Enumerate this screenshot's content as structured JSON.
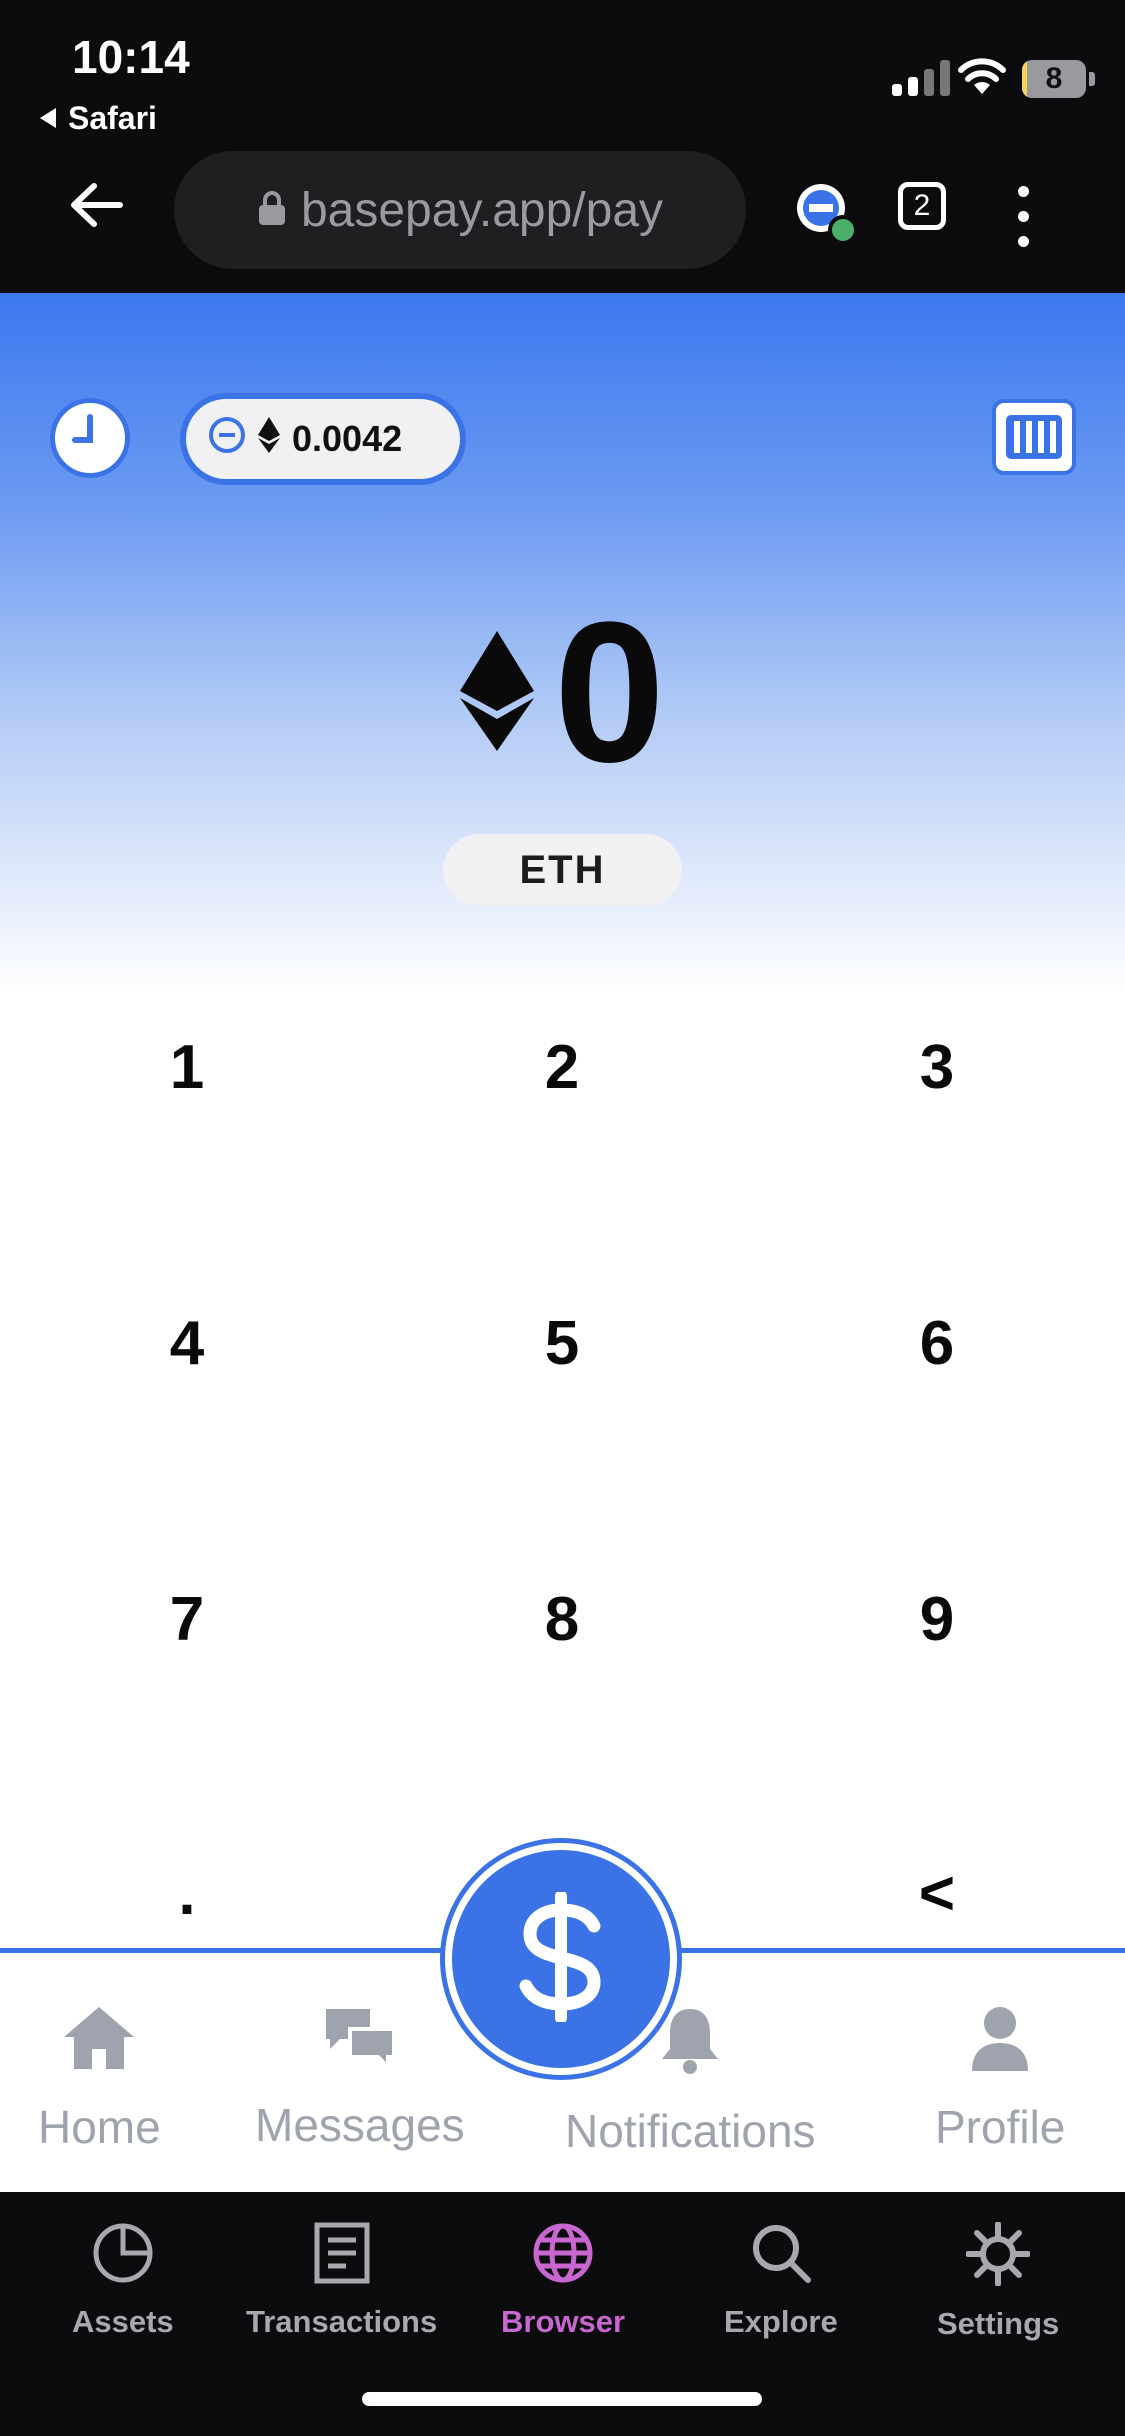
{
  "status": {
    "time": "10:14",
    "back_app": "Safari",
    "battery": "8",
    "battery_level": 0.08
  },
  "browser": {
    "url": "basepay.app/pay",
    "tab_count": "2"
  },
  "page": {
    "balance": "0.0042",
    "amount": "0",
    "currency": "ETH",
    "keypad": [
      "1",
      "2",
      "3",
      "4",
      "5",
      "6",
      "7",
      "8",
      "9",
      ".",
      "<"
    ]
  },
  "app_nav": {
    "items": [
      {
        "label": "Home",
        "icon": "home-icon"
      },
      {
        "label": "Messages",
        "icon": "messages-icon"
      },
      {
        "label": "Notifications",
        "icon": "bell-icon"
      },
      {
        "label": "Profile",
        "icon": "person-icon"
      }
    ],
    "pay_icon": "dollar-icon"
  },
  "browser_nav": {
    "items": [
      {
        "label": "Assets",
        "icon": "pie-chart-icon"
      },
      {
        "label": "Transactions",
        "icon": "document-icon"
      },
      {
        "label": "Browser",
        "icon": "globe-icon",
        "active": true
      },
      {
        "label": "Explore",
        "icon": "search-icon"
      },
      {
        "label": "Settings",
        "icon": "gear-icon"
      }
    ]
  },
  "colors": {
    "accent": "#3b73e6",
    "browser_active": "#c867d0",
    "muted": "#9ea3ad"
  }
}
